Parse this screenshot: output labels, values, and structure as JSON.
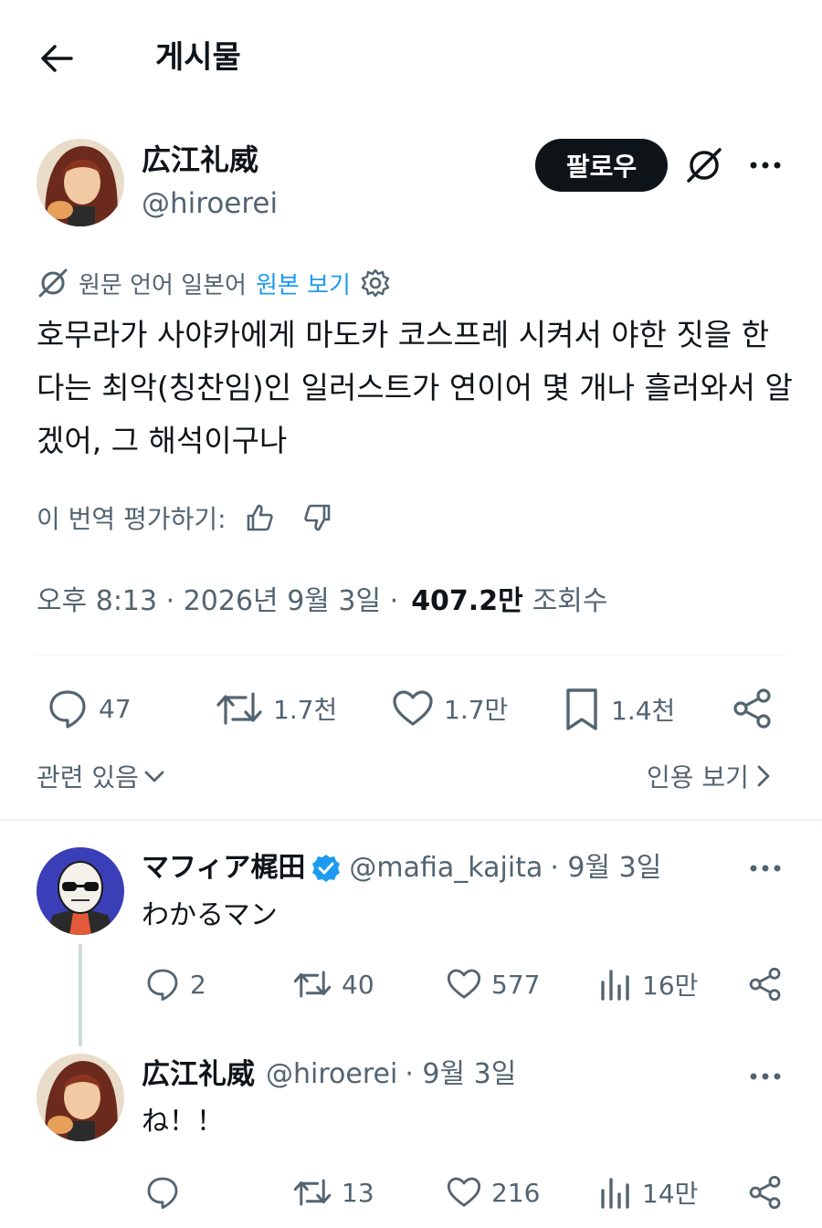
{
  "header": {
    "title": "게시물"
  },
  "author": {
    "name": "広江礼威",
    "handle": "@hiroerei"
  },
  "follow_label": "팔로우",
  "translation": {
    "source_label": "원문 언어 일본어",
    "view_original": "원본 보기"
  },
  "body": "호무라가 사야카에게 마도카 코스프레 시켜서 야한 짓을 한다는 최악(칭찬임)인 일러스트가 연이어 몇 개나 흘러와서 알겠어, 그 해석이구나",
  "rate_label": "이 번역 평가하기:",
  "meta": {
    "time_date": "오후 8:13 · 2026년 9월 3일 ·",
    "views": "407.2만",
    "views_label": "조회수"
  },
  "actions": {
    "replies": "47",
    "retweets": "1.7천",
    "likes": "1.7만",
    "bookmarks": "1.4천"
  },
  "related_label": "관련 있음",
  "quotes_label": "인용 보기",
  "replies": [
    {
      "name": "マフィア梶田",
      "verified": true,
      "handle": "@mafia_kajita",
      "date": "· 9월 3일",
      "text": "わかるマン",
      "stats": {
        "replies": "2",
        "retweets": "40",
        "likes": "577",
        "views": "16만"
      }
    },
    {
      "name": "広江礼威",
      "verified": false,
      "handle": "@hiroerei",
      "date": "· 9월 3일",
      "text": "ね！！",
      "stats": {
        "replies": "",
        "retweets": "13",
        "likes": "216",
        "views": "14만"
      }
    }
  ],
  "colors": {
    "accent": "#1d9bf0",
    "text": "#0f1419",
    "secondary": "#536471",
    "follow_bg": "#0f1419"
  },
  "icons": [
    "back-arrow-icon",
    "grok-icon",
    "more-icon",
    "translate-icon",
    "gear-icon",
    "thumbs-up-icon",
    "thumbs-down-icon",
    "reply-icon",
    "retweet-icon",
    "heart-icon",
    "bookmark-icon",
    "share-icon",
    "chevron-down-icon",
    "chevron-right-icon",
    "verified-badge-icon",
    "views-icon"
  ]
}
